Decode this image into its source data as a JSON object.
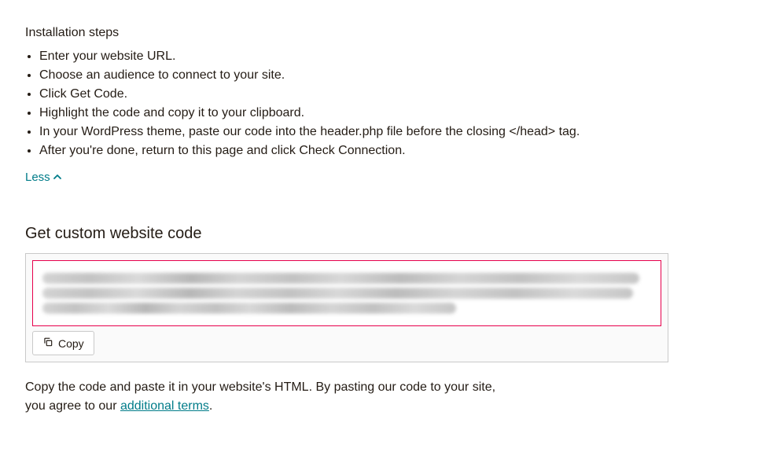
{
  "installation": {
    "heading": "Installation steps",
    "steps": [
      "Enter your website URL.",
      "Choose an audience to connect to your site.",
      "Click Get Code.",
      "Highlight the code and copy it to your clipboard.",
      "In your WordPress theme, paste our code into the header.php file before the closing </head> tag.",
      "After you're done, return to this page and click Check Connection."
    ],
    "less_label": "Less"
  },
  "code_section": {
    "title": "Get custom website code",
    "copy_label": "Copy"
  },
  "footer": {
    "line1": "Copy the code and paste it in your website's HTML. By pasting our code to your site,",
    "line2_prefix": "you agree to our ",
    "link_text": "additional terms",
    "line2_suffix": "."
  }
}
